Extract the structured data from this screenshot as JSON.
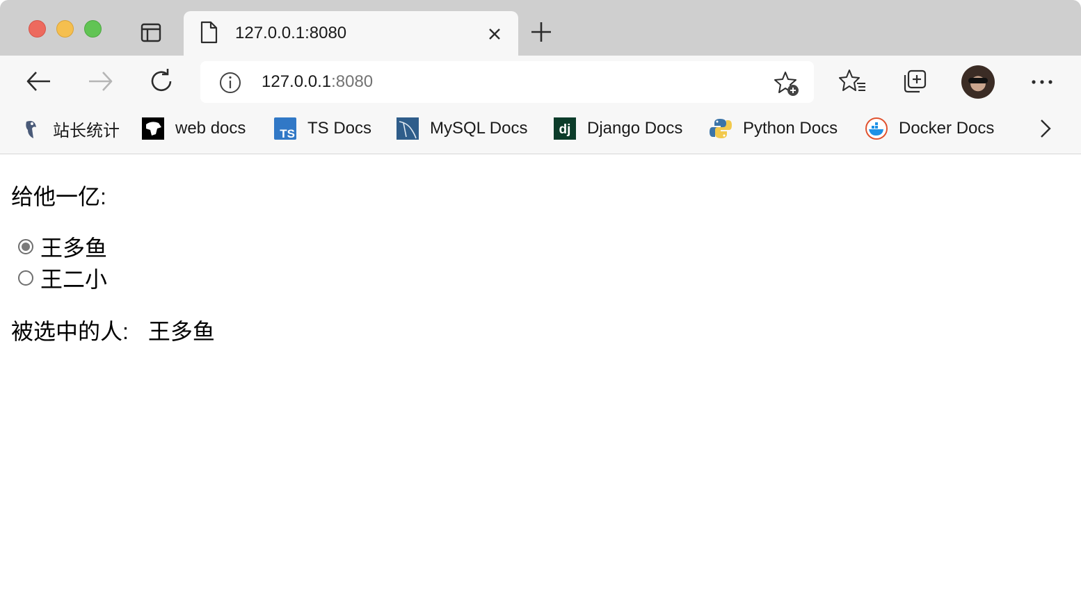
{
  "browser": {
    "tab": {
      "title": "127.0.0.1:8080",
      "page_icon": "page-icon",
      "close_icon": "close-icon"
    },
    "new_tab_icon": "plus-icon",
    "address": {
      "host": "127.0.0.1",
      "port": ":8080",
      "info_icon": "info-icon",
      "favorite_add_icon": "star-plus-icon"
    },
    "toolbar_icons": [
      "back-arrow-icon",
      "forward-arrow-icon",
      "refresh-icon",
      "favorites-icon",
      "collections-icon",
      "avatar",
      "more-icon"
    ],
    "bookmarks": [
      {
        "label": "站长统计",
        "icon": "zhanzhang-icon"
      },
      {
        "label": "web docs",
        "icon": "mdn-icon"
      },
      {
        "label": "TS Docs",
        "icon": "ts-icon",
        "icon_text": "TS"
      },
      {
        "label": "MySQL Docs",
        "icon": "mysql-icon"
      },
      {
        "label": "Django Docs",
        "icon": "django-icon",
        "icon_text": "dj"
      },
      {
        "label": "Python Docs",
        "icon": "python-icon"
      },
      {
        "label": "Docker Docs",
        "icon": "docker-icon"
      }
    ]
  },
  "page": {
    "question_label": "给他一亿:",
    "options": [
      {
        "label": "王多鱼",
        "checked": true
      },
      {
        "label": "王二小",
        "checked": false
      }
    ],
    "selected_label": "被选中的人:",
    "selected_value": "王多鱼"
  },
  "colors": {
    "tabstrip": "#cfcfcf",
    "toolbar": "#f7f7f7",
    "traffic_red": "#ed6a5e",
    "traffic_yellow": "#f5bf4f",
    "traffic_green": "#61c454",
    "ts_blue": "#3178c6",
    "django_green": "#0c4b33"
  }
}
